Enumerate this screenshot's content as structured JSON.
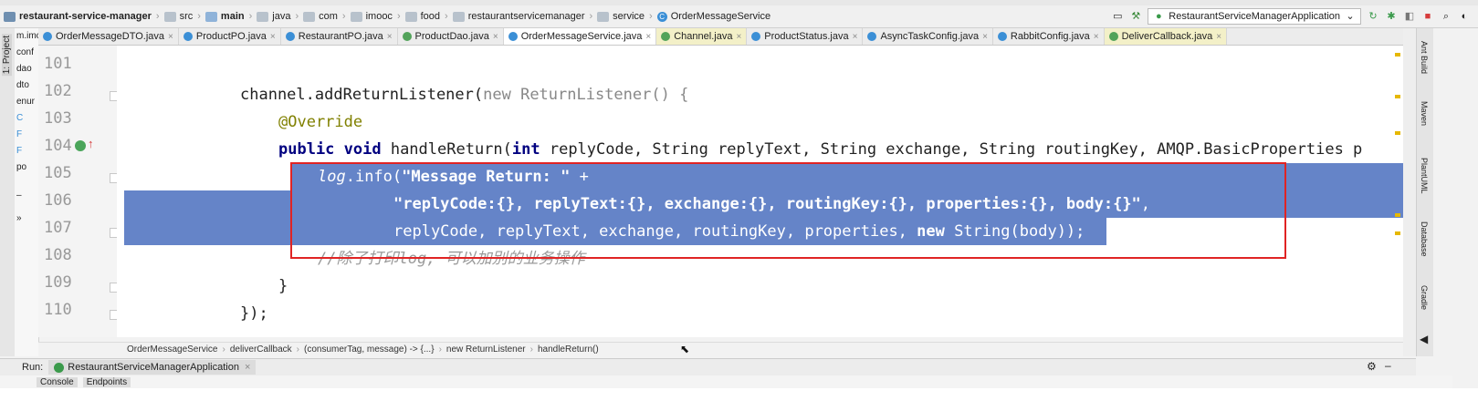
{
  "breadcrumb_nav": [
    {
      "label": "restaurant-service-manager",
      "icon": "module-icon"
    },
    {
      "label": "src",
      "icon": "folder-icon"
    },
    {
      "label": "main",
      "icon": "source-folder-icon"
    },
    {
      "label": "java",
      "icon": "folder-icon"
    },
    {
      "label": "com",
      "icon": "package-icon"
    },
    {
      "label": "imooc",
      "icon": "package-icon"
    },
    {
      "label": "food",
      "icon": "package-icon"
    },
    {
      "label": "restaurantservicemanager",
      "icon": "package-icon"
    },
    {
      "label": "service",
      "icon": "package-icon"
    },
    {
      "label": "OrderMessageService",
      "icon": "class-icon"
    }
  ],
  "toolbar": {
    "run_config": "RestaurantServiceManagerApplication"
  },
  "left_strip": {
    "project_label": "1: Project"
  },
  "project_panel": {
    "items": [
      "m.imc",
      "conf",
      "dao",
      "dto",
      "enur",
      "C",
      "F",
      "F",
      "po",
      "–",
      "»"
    ]
  },
  "tabs": [
    {
      "label": "OrderMessageDTO.java",
      "kind": "class"
    },
    {
      "label": "ProductPO.java",
      "kind": "class"
    },
    {
      "label": "RestaurantPO.java",
      "kind": "class"
    },
    {
      "label": "ProductDao.java",
      "kind": "interface"
    },
    {
      "label": "OrderMessageService.java",
      "kind": "class",
      "active": true
    },
    {
      "label": "Channel.java",
      "kind": "interface"
    },
    {
      "label": "ProductStatus.java",
      "kind": "class"
    },
    {
      "label": "AsyncTaskConfig.java",
      "kind": "class"
    },
    {
      "label": "RabbitConfig.java",
      "kind": "class"
    },
    {
      "label": "DeliverCallback.java",
      "kind": "interface"
    }
  ],
  "editor": {
    "line_numbers": [
      "101",
      "102",
      "103",
      "104",
      "105",
      "106",
      "107",
      "108",
      "109",
      "110"
    ],
    "code": {
      "l102_a": "channel.",
      "l102_b": "addReturnListener(",
      "l102_new": "new",
      "l102_c": " ReturnListener() {",
      "l103": "@Override",
      "l104_kw": "public void",
      "l104_a": " handleReturn(",
      "l104_int": "int",
      "l104_b": " replyCode, String replyText, String exchange, String routingKey, AMQP.BasicProperties p",
      "l105_log": "log",
      "l105_a": ".info(",
      "l105_str": "\"Message Return: \"",
      "l105_plus": " +",
      "l106_str": "\"replyCode:{}, replyText:{}, exchange:{}, routingKey:{}, properties:{}, body:{}\"",
      "l106_comma": ",",
      "l107_a": "replyCode, replyText, exchange, routingKey, properties, ",
      "l107_new": "new",
      "l107_b": " String(body));",
      "l108": "//除了打印log, 可以加别的业务操作",
      "l109": "}",
      "l110": "});"
    }
  },
  "structure_breadcrumb": [
    "OrderMessageService",
    "deliverCallback",
    "(consumerTag, message) -> {...}",
    "new ReturnListener",
    "handleReturn()"
  ],
  "run_bar": {
    "label": "Run:",
    "tab": "RestaurantServiceManagerApplication"
  },
  "console_tabs": [
    "Console",
    "Endpoints"
  ],
  "right_bar": [
    "Ant Build",
    "Maven",
    "PlantUML",
    "Database",
    "Gradle"
  ],
  "colors": {
    "selection": "#6584c8",
    "highlight_box": "#e02424",
    "keyword": "#000080"
  }
}
